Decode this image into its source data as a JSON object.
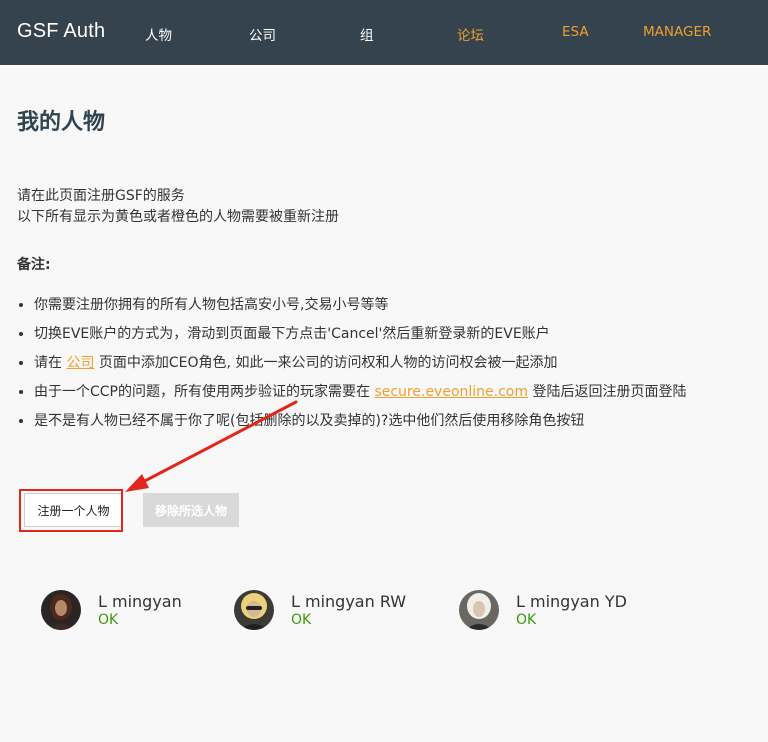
{
  "nav": {
    "brand": "GSF Auth",
    "items": [
      {
        "label": "人物"
      },
      {
        "label": "公司"
      },
      {
        "label": "组"
      },
      {
        "label": "论坛"
      },
      {
        "label": "ESA"
      },
      {
        "label": "MANAGER"
      }
    ],
    "accent_color": "#f0a030"
  },
  "page": {
    "title": "我的人物",
    "intro_line1": "请在此页面注册GSF的服务",
    "intro_line2": "以下所有显示为黄色或者橙色的人物需要被重新注册",
    "notes_heading": "备注:",
    "notes": {
      "n1": "你需要注册你拥有的所有人物包括高安小号,交易小号等等",
      "n2": "切换EVE账户的方式为，滑动到页面最下方点击'Cancel'然后重新登录新的EVE账户",
      "n3_before": "请在 ",
      "n3_link": "公司",
      "n3_after": " 页面中添加CEO角色, 如此一来公司的访问权和人物的访问权会被一起添加",
      "n4_before": "由于一个CCP的问题，所有使用两步验证的玩家需要在 ",
      "n4_link": "secure.eveonline.com",
      "n4_after": " 登陆后返回注册页面登陆",
      "n5": "是不是有人物已经不属于你了呢(包括删除的以及卖掉的)?选中他们然后使用移除角色按钮"
    }
  },
  "actions": {
    "add_label": "注册一个人物",
    "remove_label": "移除所选人物"
  },
  "characters": [
    {
      "name": "L mingyan",
      "status": "OK"
    },
    {
      "name": "L mingyan RW",
      "status": "OK"
    },
    {
      "name": "L mingyan YD",
      "status": "OK"
    }
  ],
  "colors": {
    "ok": "#3a9a0c",
    "annotation": "#e2261c",
    "topbar": "#34434e"
  }
}
